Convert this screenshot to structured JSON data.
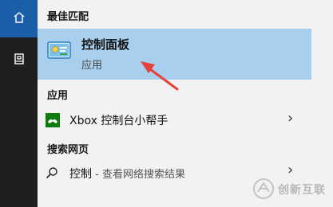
{
  "taskbar": {
    "icons": [
      "home-icon",
      "notebook-icon"
    ],
    "accent": "#1a5fa8"
  },
  "sections": {
    "best_match": "最佳匹配",
    "apps": "应用",
    "web": "搜索网页"
  },
  "best_match": {
    "title": "控制面板",
    "subtitle": "应用",
    "icon": "control-panel-icon",
    "highlight": "#a9cfee"
  },
  "apps": [
    {
      "label": "Xbox 控制台小帮手",
      "icon": "xbox-icon"
    }
  ],
  "web": {
    "query": "控制",
    "separator": " - ",
    "hint": "查看网络搜索结果",
    "icon": "search-icon"
  },
  "annotation": {
    "arrow_color": "#e8403a"
  },
  "watermark": {
    "text": "创新互联"
  }
}
